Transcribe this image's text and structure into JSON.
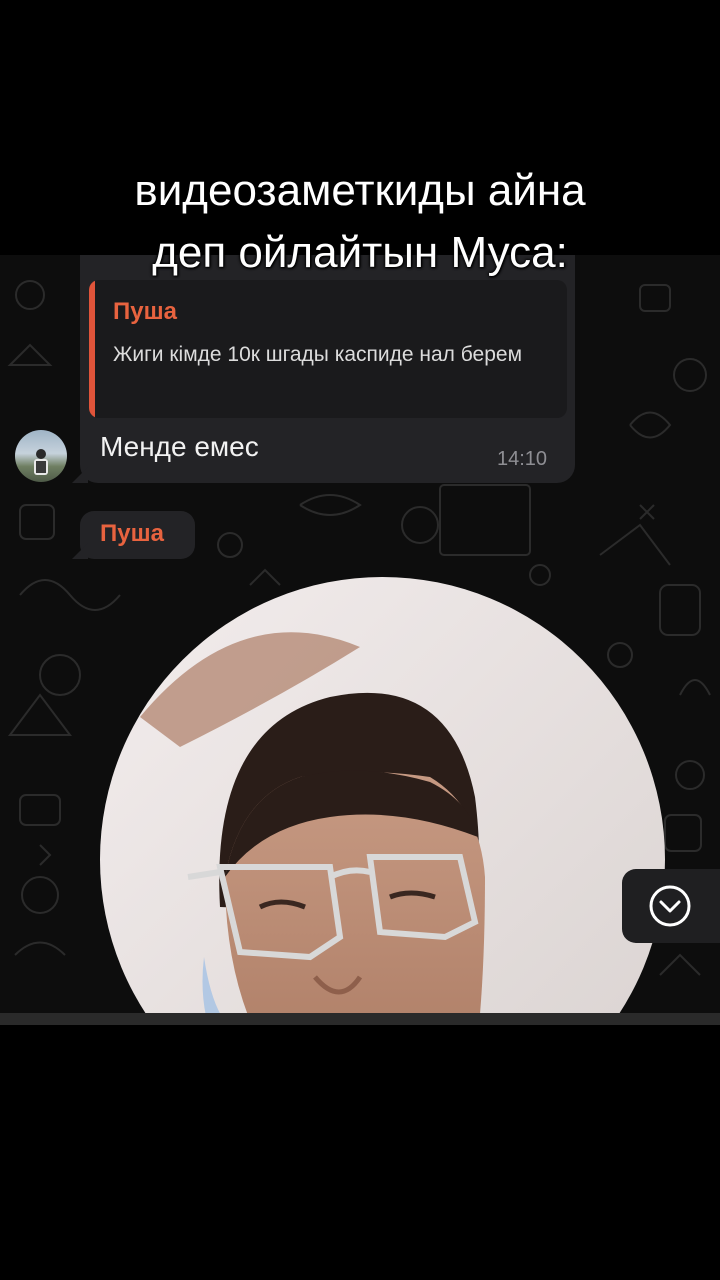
{
  "caption": {
    "line1": "видеозаметкиды айна",
    "line2": "деп ойлайтын Муса:"
  },
  "chat": {
    "reply_message": {
      "quoted_sender": "Пуша",
      "quoted_text": "Жиги кімде 10к шгады каспиде нал берем",
      "text": "Менде емес",
      "time": "14:10"
    },
    "next_sender": "Пуша",
    "scroll_button_icon": "chevron-down-icon"
  },
  "colors": {
    "accent": "#e8633f",
    "bubble": "#232326",
    "background": "#0d0d0d"
  }
}
